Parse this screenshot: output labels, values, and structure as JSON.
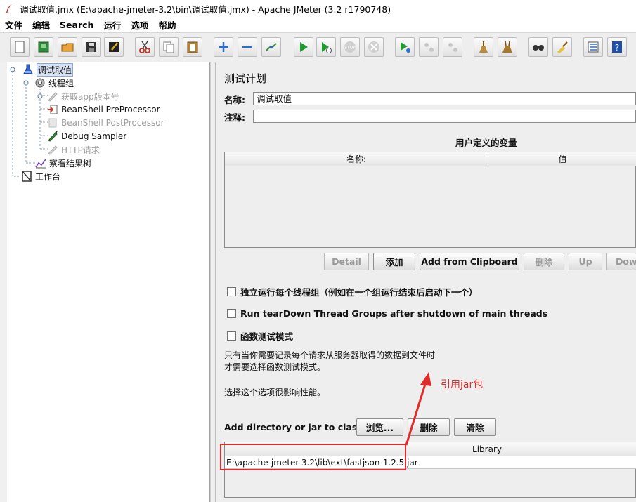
{
  "window": {
    "title": "调试取值.jmx (E:\\apache-jmeter-3.2\\bin\\调试取值.jmx) - Apache JMeter (3.2 r1790748)"
  },
  "menu": [
    "文件",
    "编辑",
    "Search",
    "运行",
    "选项",
    "帮助"
  ],
  "toolbar_icons": [
    "new-icon",
    "templates-icon",
    "open-icon",
    "save-icon",
    "save-as-icon",
    "cut-icon",
    "copy-icon",
    "paste-icon",
    "expand-icon",
    "collapse-icon",
    "toggle-icon",
    "start-icon",
    "start-no-pause-icon",
    "stop-icon",
    "shutdown-icon",
    "remote-start-icon",
    "remote-stop-icon",
    "remote-shutdown-icon",
    "clear-icon",
    "clear-all-icon",
    "search-icon",
    "reset-search-icon",
    "function-helper-icon",
    "help-icon"
  ],
  "tree": {
    "root": "调试取值",
    "thread_group": "线程组",
    "items": [
      {
        "label": "获取app版本号",
        "enabled": false
      },
      {
        "label": "BeanShell PreProcessor",
        "enabled": true
      },
      {
        "label": "BeanShell PostProcessor",
        "enabled": false
      },
      {
        "label": "Debug Sampler",
        "enabled": true
      },
      {
        "label": "HTTP请求",
        "enabled": false
      }
    ],
    "listener": "察看结果树",
    "workbench": "工作台"
  },
  "panel": {
    "title": "测试计划",
    "name_label": "名称:",
    "name_value": "调试取值",
    "comment_label": "注释:",
    "comment_value": "",
    "variables_title": "用户定义的变量",
    "col_name": "名称:",
    "col_value": "值",
    "buttons": {
      "detail": "Detail",
      "add": "添加",
      "add_clipboard": "Add from Clipboard",
      "delete": "删除",
      "up": "Up",
      "down": "Dow"
    },
    "checks": {
      "serialize": "独立运行每个线程组（例如在一个组运行结束后启动下一个）",
      "teardown": "Run tearDown Thread Groups after shutdown of main threads",
      "functional": "函数测试模式"
    },
    "note_line1": "只有当你需要记录每个请求从服务器取得的数据到文件时",
    "note_line2": "才需要选择函数测试模式。",
    "note_line3": "选择这个选项很影响性能。",
    "classpath_label": "Add directory or jar to classpath",
    "browse": "浏览...",
    "cp_delete": "删除",
    "cp_clear": "清除",
    "library_header": "Library",
    "library_row": "E:\\apache-jmeter-3.2\\lib\\ext\\fastjson-1.2.5.jar"
  },
  "annotation": {
    "text": "引用jar包",
    "color": "#e12b2b"
  }
}
